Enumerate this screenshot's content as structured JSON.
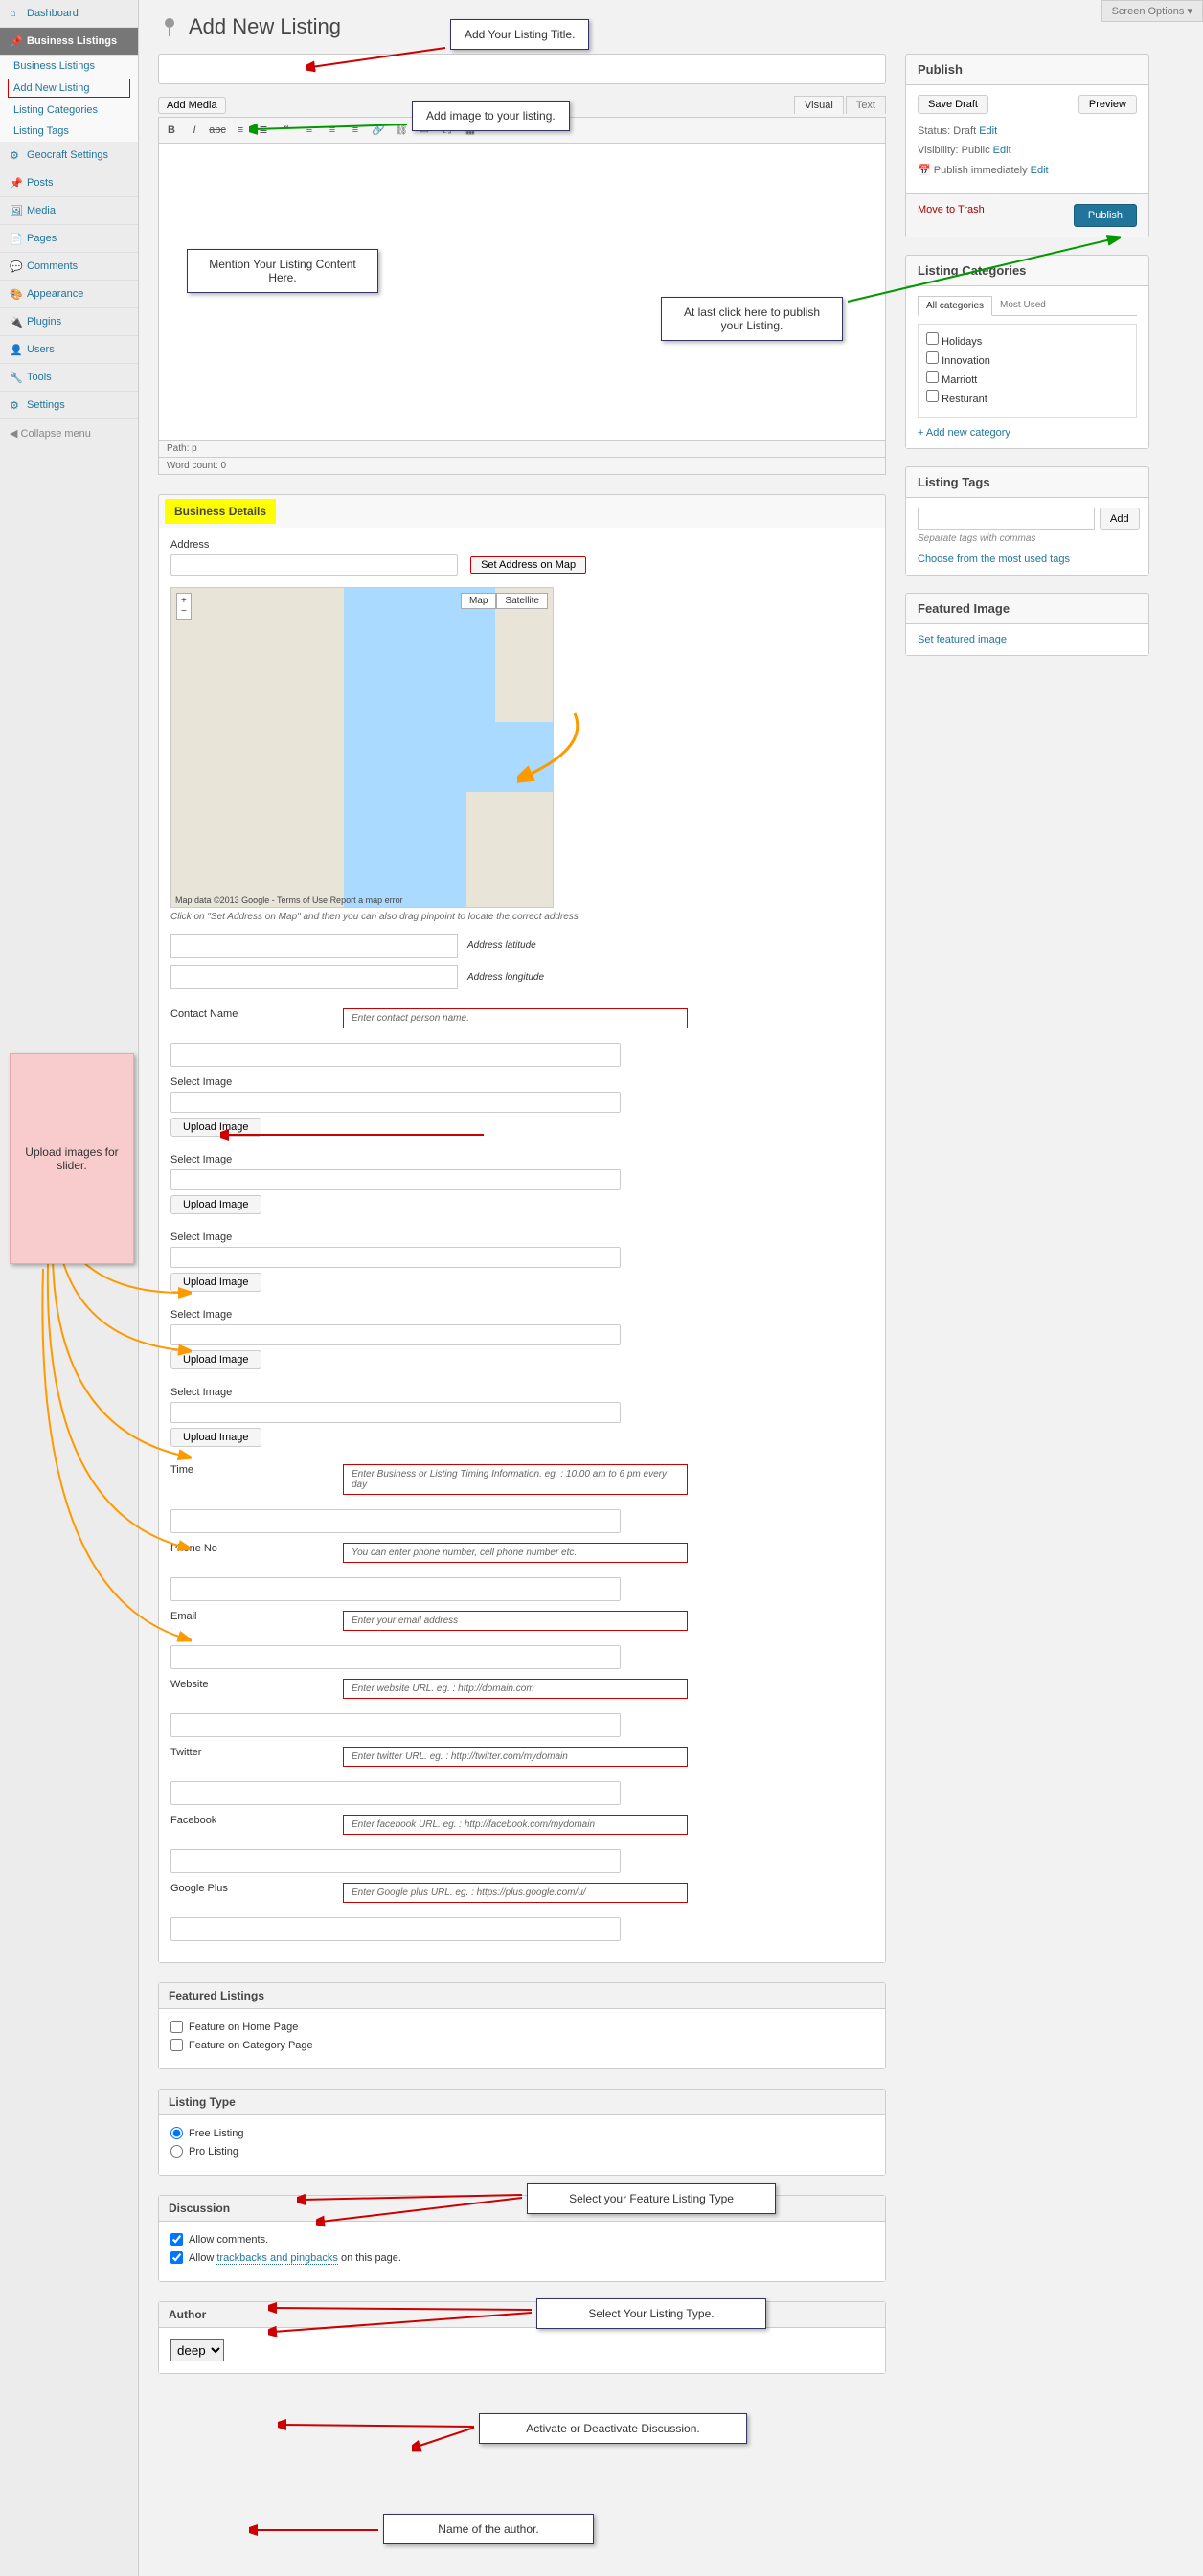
{
  "screen_options": "Screen Options ▾",
  "sidebar": {
    "dashboard": "Dashboard",
    "business_listings": "Business Listings",
    "sub_bl": "Business Listings",
    "sub_add": "Add New Listing",
    "sub_cat": "Listing Categories",
    "sub_tags": "Listing Tags",
    "geocraft": "Geocraft Settings",
    "posts": "Posts",
    "media": "Media",
    "pages": "Pages",
    "comments": "Comments",
    "appearance": "Appearance",
    "plugins": "Plugins",
    "users": "Users",
    "tools": "Tools",
    "settings": "Settings",
    "collapse": "Collapse menu"
  },
  "page_title": "Add New Listing",
  "add_media": "Add Media",
  "tabs": {
    "visual": "Visual",
    "text": "Text"
  },
  "editor_path": "Path: p",
  "word_count": "Word count: 0",
  "business_details": {
    "heading": "Business Details",
    "address_label": "Address",
    "set_on_map": "Set Address on Map",
    "map_type_map": "Map",
    "map_type_sat": "Satellite",
    "map_credit": "Map data ©2013 Google - Terms of Use",
    "map_report": "Report a map error",
    "map_hint": "Click on \"Set Address on Map\" and then you can also drag pinpoint to locate the correct address",
    "lat_label": "Address latitude",
    "lon_label": "Address longitude",
    "contact_name": "Contact Name",
    "contact_hint": "Enter contact person name.",
    "select_image": "Select Image",
    "upload_image": "Upload Image",
    "time_label": "Time",
    "time_hint": "Enter Business or Listing Timing Information. eg. : 10.00 am to 6 pm every day",
    "phone_label": "Phone No",
    "phone_hint": "You can enter phone number, cell phone number etc.",
    "email_label": "Email",
    "email_hint": "Enter your email address",
    "website_label": "Website",
    "website_hint": "Enter website URL. eg. : http://domain.com",
    "twitter_label": "Twitter",
    "twitter_hint": "Enter twitter URL. eg. : http://twitter.com/mydomain",
    "facebook_label": "Facebook",
    "facebook_hint": "Enter facebook URL. eg. : http://facebook.com/mydomain",
    "gplus_label": "Google Plus",
    "gplus_hint": "Enter Google plus URL. eg. : https://plus.google.com/u/"
  },
  "featured": {
    "heading": "Featured Listings",
    "home": "Feature on Home Page",
    "category": "Feature on Category Page"
  },
  "listing_type": {
    "heading": "Listing Type",
    "free": "Free Listing",
    "pro": "Pro Listing"
  },
  "discussion": {
    "heading": "Discussion",
    "allow_comments": "Allow comments.",
    "allow_tb_prefix": "Allow ",
    "allow_tb_link": "trackbacks and pingbacks",
    "allow_tb_suffix": " on this page."
  },
  "author": {
    "heading": "Author",
    "value": "deep"
  },
  "publish": {
    "heading": "Publish",
    "save_draft": "Save Draft",
    "preview": "Preview",
    "status": "Status: Draft ",
    "edit": "Edit",
    "visibility": "Visibility: Public ",
    "publish_when": "Publish immediately ",
    "trash": "Move to Trash",
    "publish_btn": "Publish"
  },
  "categories": {
    "heading": "Listing Categories",
    "tab_all": "All categories",
    "tab_used": "Most Used",
    "items": [
      "Holidays",
      "Innovation",
      "Marriott",
      "Resturant"
    ],
    "add_new": "+ Add new category"
  },
  "tags": {
    "heading": "Listing Tags",
    "add": "Add",
    "hint": "Separate tags with commas",
    "choose": "Choose from the most used tags"
  },
  "featured_image": {
    "heading": "Featured Image",
    "link": "Set featured image"
  },
  "callouts": {
    "title": "Add Your Listing Title.",
    "image": "Add image to your listing.",
    "content": "Mention Your Listing Content Here.",
    "publish": "At last click here to publish your Listing.",
    "slider": "Upload images for slider.",
    "feature_type": "Select your Feature Listing Type",
    "listing_type": "Select Your Listing Type.",
    "discussion": "Activate or Deactivate Discussion.",
    "author": "Name of the author."
  }
}
